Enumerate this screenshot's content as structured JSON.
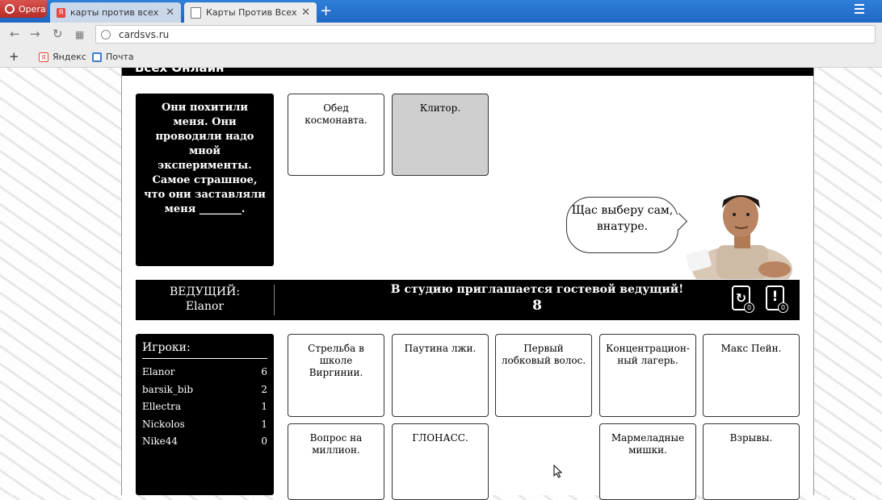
{
  "browser": {
    "opera_label": "Opera",
    "tabs": [
      {
        "title": "карты против всех онлайн",
        "close": "✕"
      },
      {
        "title": "Карты Против Всех Онлайн",
        "close": "✕"
      }
    ],
    "new_tab": "+",
    "url": "cardsvs.ru",
    "bookmarks": {
      "add": "+",
      "items": [
        "Яндекс",
        "Почта"
      ]
    }
  },
  "site": {
    "header_title": "Всех Онлайн"
  },
  "question": {
    "text": "Они похитили меня. Они проводили надо мной эксперименты. Самое страшное, что они заставляли меня ________."
  },
  "played_cards": [
    "Обед космонавта.",
    "Клитор."
  ],
  "speech_bubble": "Щас выберу сам, внатуре.",
  "host_bar": {
    "label": "ВЕДУЩИЙ:",
    "name": "Elanor",
    "message": "В студию приглашается гостевой ведущий!",
    "timer": "8",
    "refresh_badge": "0",
    "alert_symbol": "!",
    "alert_badge": "0"
  },
  "players": {
    "title": "Игроки:",
    "list": [
      {
        "name": "Elanor",
        "score": "6"
      },
      {
        "name": "barsik_bib",
        "score": "2"
      },
      {
        "name": "Ellectra",
        "score": "1"
      },
      {
        "name": "Nickolos",
        "score": "1"
      },
      {
        "name": "Nike44",
        "score": "0"
      }
    ]
  },
  "hand": [
    "Стрельба в школе Виргинии.",
    "Паутина лжи.",
    "Первый лобковый волос.",
    "Концентрацион-ный лагерь.",
    "Макс Пейн.",
    "Вопрос на миллион.",
    "ГЛОНАСС.",
    "Мармеладные мишки.",
    "Взрывы."
  ],
  "colors": {
    "tabbar": "#1f67c4",
    "opera": "#c9302c",
    "card_black": "#000000",
    "selected_card": "#cfcfcf"
  }
}
